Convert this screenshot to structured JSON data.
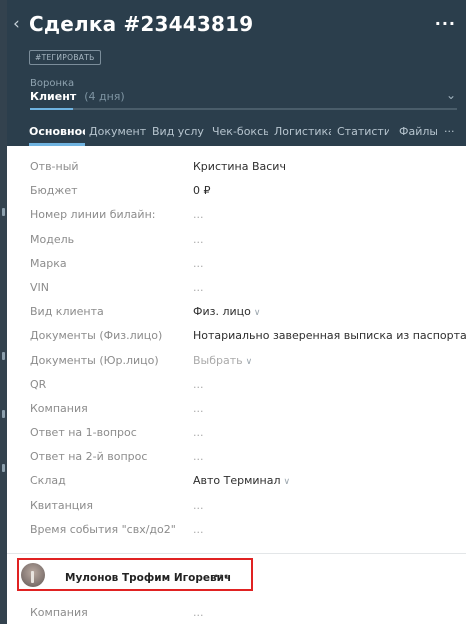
{
  "deal": {
    "title": "Сделка #23443819",
    "tag_button": "#ТЕГИРОВАТЬ",
    "funnel_label": "Воронка",
    "stage": "Клиент",
    "stage_days": "(4 дня)",
    "stage_progress": 0.1
  },
  "icons": {
    "back": "chevron-left-icon",
    "more": "more-dots-icon",
    "stage_toggle": "chevron-down-icon"
  },
  "tabs": [
    "Основное",
    "Документы",
    "Вид услуг",
    "Чек-боксы",
    "Логистика",
    "Статистика",
    "Файлы"
  ],
  "tabs_more": "···",
  "fields": [
    {
      "label": "Отв-ный",
      "value": "Кристина Васич",
      "empty": false,
      "dropdown": false
    },
    {
      "label": "Бюджет",
      "value": "0 ₽",
      "empty": false,
      "dropdown": false
    },
    {
      "label": "Номер линии билайн:",
      "value": "...",
      "empty": true,
      "dropdown": false
    },
    {
      "label": "Модель",
      "value": "...",
      "empty": true,
      "dropdown": false
    },
    {
      "label": "Марка",
      "value": "...",
      "empty": true,
      "dropdown": false
    },
    {
      "label": "VIN",
      "value": "...",
      "empty": true,
      "dropdown": false
    },
    {
      "label": "Вид клиента",
      "value": "Физ. лицо",
      "empty": false,
      "dropdown": true
    },
    {
      "label": "Документы (Физ.лицо)",
      "value": "Нотариально заверенная выписка из паспорта",
      "empty": false,
      "dropdown": true
    },
    {
      "label": "Документы (Юр.лицо)",
      "value": "Выбрать",
      "empty": true,
      "dropdown": true
    },
    {
      "label": "QR",
      "value": "...",
      "empty": true,
      "dropdown": false
    },
    {
      "label": "Компания",
      "value": "...",
      "empty": true,
      "dropdown": false
    },
    {
      "label": "Ответ на 1-вопрос",
      "value": "...",
      "empty": true,
      "dropdown": false
    },
    {
      "label": "Ответ на 2-й вопрос",
      "value": "...",
      "empty": true,
      "dropdown": false
    },
    {
      "label": "Склад",
      "value": "Авто Терминал",
      "empty": false,
      "dropdown": true
    },
    {
      "label": "Квитанция",
      "value": "...",
      "empty": true,
      "dropdown": false
    },
    {
      "label": "Время события \"свх/до2\"",
      "value": "...",
      "empty": true,
      "dropdown": false
    }
  ],
  "contact": {
    "name": "Мулонов Трофим Игоревич",
    "more": "···",
    "company_label": "Компания",
    "company_value": "..."
  },
  "colors": {
    "header_bg": "#2b3e4c",
    "accent": "#6fb3e0",
    "highlight_border": "#e02222"
  }
}
